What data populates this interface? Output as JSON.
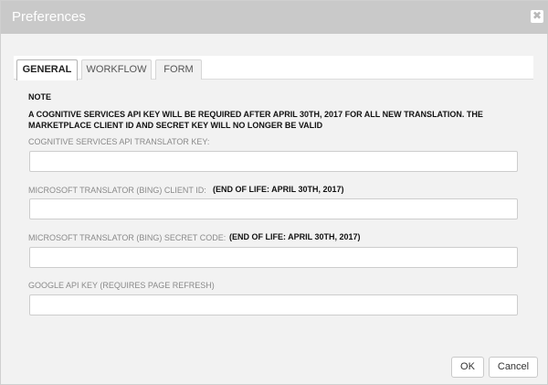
{
  "dialog": {
    "title": "Preferences",
    "close_glyph": "✖",
    "close_icon": "close-icon"
  },
  "tabs": [
    {
      "label": "GENERAL",
      "active": true
    },
    {
      "label": "WORKFLOW",
      "active": false
    },
    {
      "label": "FORM",
      "active": false
    }
  ],
  "general": {
    "note_title": "NOTE",
    "note_text": "A COGNITIVE SERVICES API KEY WILL BE REQUIRED AFTER APRIL 30TH, 2017 FOR ALL NEW TRANSLATION. THE MARKETPLACE CLIENT ID AND SECRET KEY WILL NO LONGER BE VALID",
    "fields": [
      {
        "label": "COGNITIVE SERVICES API TRANSLATOR KEY:",
        "eol": "",
        "value": ""
      },
      {
        "label": "MICROSOFT TRANSLATOR (BING) CLIENT ID:",
        "eol": "(END OF LIFE: APRIL 30TH, 2017)",
        "value": ""
      },
      {
        "label": "MICROSOFT TRANSLATOR (BING) SECRET CODE:",
        "eol": "(END OF LIFE: APRIL 30TH, 2017)",
        "value": ""
      },
      {
        "label": "GOOGLE API KEY (REQUIRES PAGE REFRESH)",
        "eol": "",
        "value": ""
      }
    ]
  },
  "buttons": {
    "ok": "OK",
    "cancel": "Cancel"
  }
}
